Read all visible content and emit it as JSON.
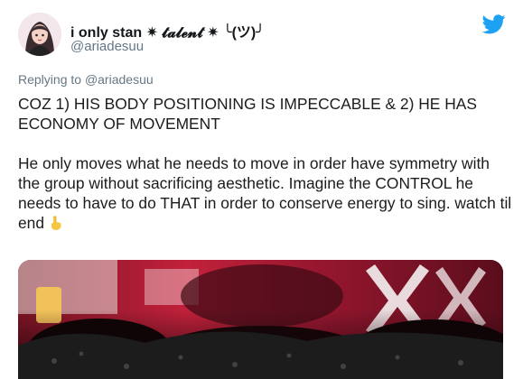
{
  "tweet": {
    "display_name": "i only stan ✷ 𝓽𝓪𝓵𝓮𝓷𝓽 ✷ ╰(ツ)╯",
    "handle": "@ariadesuu",
    "replying_prefix": "Replying to ",
    "replying_handle": "@ariadesuu",
    "paragraph_1": "COZ 1) HIS BODY POSITIONING IS IMPECCABLE & 2) HE HAS ECONOMY OF MOVEMENT",
    "paragraph_2": "He only moves what he needs to move in order have symmetry with the group without sacrificing aesthetic. Imagine the CONTROL he needs to have to do THAT in order to conserve energy to sing. watch til end",
    "emoji": "pointing-down-emoji"
  },
  "icons": {
    "brand": "twitter-bird-icon",
    "avatar": "avatar-illustration"
  },
  "colors": {
    "twitter_blue": "#1da1f2",
    "secondary_text": "#657786",
    "body_text": "#14171a",
    "media_bg": "#4a0f1a"
  }
}
